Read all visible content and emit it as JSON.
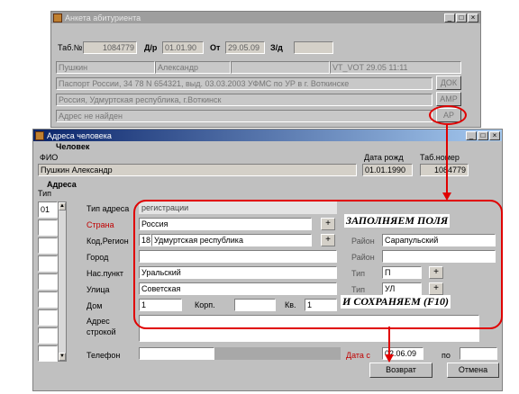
{
  "anketa": {
    "title": "Анкета абитуриента",
    "tab_label": "Таб.№",
    "tab_value": "1084779",
    "dr_label": "Д/р",
    "dr_value": "01.01.90",
    "ot_label": "От",
    "ot_value": "29.05.09",
    "zd_label": "З/д",
    "zd_value": "",
    "row1": [
      "Пушкин",
      "Александр",
      "",
      "VT_VOT 29.05 11:11"
    ],
    "passport": "Паспорт России, 34 78 N 654321, выд. 03.03.2003 УФМС по УР в г. Воткинске",
    "doc_button": "ДОК",
    "region": "Россия, Удмуртская республика, г.Воткинск",
    "amr_button": "АМР",
    "address": "Адрес не найден",
    "ar_button": "АР"
  },
  "addr_window": {
    "title": "Адреса человека",
    "person_header": "Человек",
    "fio_label": "ФИО",
    "fio_value": "Пушкин Александр",
    "birth_label": "Дата рожд",
    "birth_value": "01.01.1990",
    "tab_label": "Таб.номер",
    "tab_value": "1084779",
    "addresses_header": "Адреса",
    "type_col_label": "Тип",
    "type_rows": [
      "01",
      "",
      "",
      "",
      "",
      "",
      "",
      "",
      ""
    ],
    "fields": {
      "addr_type_label": "Тип адреса",
      "addr_type_value": "регистрации",
      "country_label": "Страна",
      "country_value": "Россия",
      "code_region_label": "Код,Регион",
      "region_code": "18",
      "region_value": "Удмуртская республика",
      "city_label": "Город",
      "city_value": "",
      "settlement_label": "Нас.пункт",
      "settlement_value": "Уральский",
      "street_label": "Улица",
      "street_value": "Советская",
      "house_label": "Дом",
      "house_value": "1",
      "korp_label": "Корп.",
      "korp_value": "",
      "kv_label": "Кв.",
      "kv_value": "1",
      "address_line_label": "Адрес\nстрокой",
      "address_line_value": "",
      "phone_label": "Телефон",
      "phone_value": "",
      "district_label": "Район",
      "district_value": "Сарапульский",
      "district2_label": "Район",
      "district2_value": "",
      "type1_label": "Тип",
      "type1_value": "П",
      "type2_label": "Тип",
      "type2_value": "УЛ",
      "date_from_label": "Дата с",
      "date_from_value": "02.06.09",
      "to_label": "по",
      "to_value": ""
    },
    "plus": "+",
    "return_button": "Возврат",
    "cancel_button": "Отмена"
  },
  "annotations": {
    "fill_fields": "ЗАПОЛНЯЕМ ПОЛЯ",
    "save": "И СОХРАНЯЕМ (F10)"
  },
  "colors": {
    "highlight": "#e00000",
    "active_title": "#0a246a",
    "inactive_title": "#9e9e9e"
  }
}
